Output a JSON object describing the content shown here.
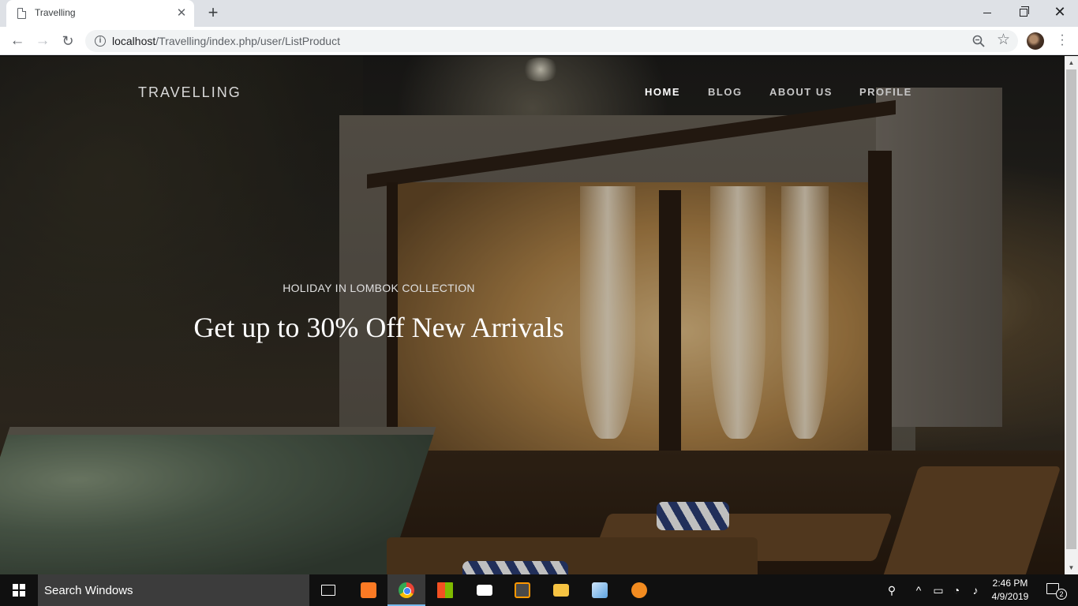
{
  "browser": {
    "tab_title": "Travelling",
    "close_glyph": "✕",
    "new_tab_glyph": "+",
    "url_host": "localhost",
    "url_path": "/Travelling/index.php/user/ListProduct",
    "icons": [
      "page-icon",
      "back-icon",
      "forward-icon",
      "reload-icon",
      "info-icon",
      "zoom-icon",
      "star-icon",
      "avatar",
      "menu-icon"
    ]
  },
  "site": {
    "brand": "TRAVELLING",
    "nav": {
      "home": "HOME",
      "blog": "BLOG",
      "about": "ABOUT US",
      "profile": "PROFILE"
    },
    "hero": {
      "subtitle": "HOLIDAY IN LOMBOK COLLECTION",
      "title": "Get up to 30% Off New Arrivals"
    }
  },
  "taskbar": {
    "search_placeholder": "Search Windows",
    "time": "2:46 PM",
    "date": "4/9/2019",
    "notification_count": "2",
    "apps": [
      "task-view",
      "xampp",
      "chrome",
      "store",
      "mail",
      "sublime-text",
      "file-explorer",
      "virtualbox",
      "app"
    ]
  }
}
